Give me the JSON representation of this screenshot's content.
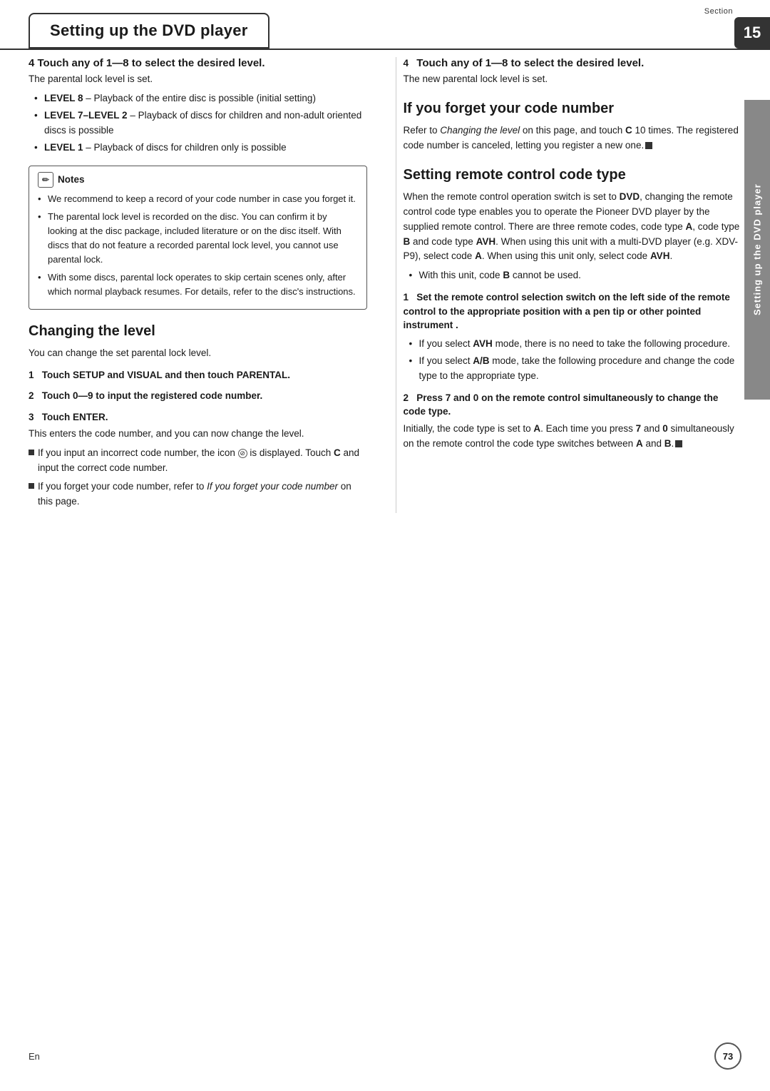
{
  "header": {
    "title": "Setting up the DVD player",
    "section_label": "Section",
    "section_number": "15"
  },
  "side_label": "Setting up the DVD player",
  "left_col": {
    "step4_heading": "4   Touch any of 1—8 to select the desired level.",
    "step4_text": "The parental lock level is set.",
    "levels": [
      "LEVEL 8 – Playback of the entire disc is possible (initial setting)",
      "LEVEL 7–LEVEL 2 – Playback of discs for children and non-adult oriented discs is possible",
      "LEVEL 1 – Playback of discs for children only is possible"
    ],
    "notes_title": "Notes",
    "notes_items": [
      "We recommend to keep a record of your code number in case you forget it.",
      "The parental lock level is recorded on the disc. You can confirm it by looking at the disc package, included literature or on the disc itself. With discs that do not feature a recorded parental lock level, you cannot use parental lock.",
      "With some discs, parental lock operates to skip certain scenes only, after which normal playback resumes. For details, refer to the disc's instructions."
    ],
    "changing_heading": "Changing the level",
    "changing_sub": "You can change the set parental lock level.",
    "step1_heading": "1   Touch SETUP and VISUAL and then touch PARENTAL.",
    "step2_heading": "2   Touch 0—9 to input the registered code number.",
    "step3_heading": "3   Touch ENTER.",
    "step3_text1": "This enters the code number, and you can now change the level.",
    "step3_note1": "If you input an incorrect code number, the icon",
    "step3_note1b": "is displayed. Touch C and input the correct code number.",
    "step3_note2": "If you forget your code number, refer to",
    "step3_note2_italic": "If you forget your code number",
    "step3_note2b": "on this page."
  },
  "right_col": {
    "step4_heading": "4   Touch any of 1—8 to select the desired level.",
    "step4_text": "The new parental lock level is set.",
    "forget_heading": "If you forget your code number",
    "forget_text": "Refer to",
    "forget_italic": "Changing the level",
    "forget_text2": "on this page, and touch C 10 times. The registered code number is canceled, letting you register a new one.",
    "remote_heading": "Setting remote control code type",
    "remote_text1": "When the remote control operation switch is set to",
    "remote_bold1": "DVD",
    "remote_text2": ", changing the remote control code type enables you to operate the Pioneer DVD player by the supplied remote control. There are three remote codes, code type",
    "remote_bold2": "A",
    "remote_text3": ", code type",
    "remote_bold3": "B",
    "remote_text4": "and code type",
    "remote_bold4": "AVH",
    "remote_text5": ". When using this unit with a multi-DVD player (e.g. XDV-P9), select code",
    "remote_bold5": "A",
    "remote_text6": ". When using this unit only, select code",
    "remote_bold6": "AVH",
    "remote_text7": ".",
    "bullet1": "With this unit, code",
    "bullet1_bold": "B",
    "bullet1_end": "cannot be used.",
    "step1_heading": "1   Set the remote control selection switch on the left side of the remote control to the appropriate position with a pen tip or other pointed instrument .",
    "step1_bullet1": "If you select",
    "step1_bullet1_bold": "AVH",
    "step1_bullet1_end": "mode, there is no need to take the following procedure.",
    "step1_bullet2": "If you select",
    "step1_bullet2_bold": "A/B",
    "step1_bullet2_end": "mode, take the following procedure and change the code type to the appropriate type.",
    "step2_heading": "2   Press 7 and 0 on the remote control simultaneously to change the code type.",
    "step2_text1": "Initially, the code type is set to",
    "step2_bold1": "A",
    "step2_text2": ". Each time you press",
    "step2_bold2": "7",
    "step2_text3": "and",
    "step2_bold3": "0",
    "step2_text4": "simultaneously on the remote control the code type switches between",
    "step2_bold4": "A",
    "step2_text5": "and",
    "step2_bold5": "B",
    "step2_text6": "."
  },
  "footer": {
    "lang": "En",
    "page": "73"
  }
}
